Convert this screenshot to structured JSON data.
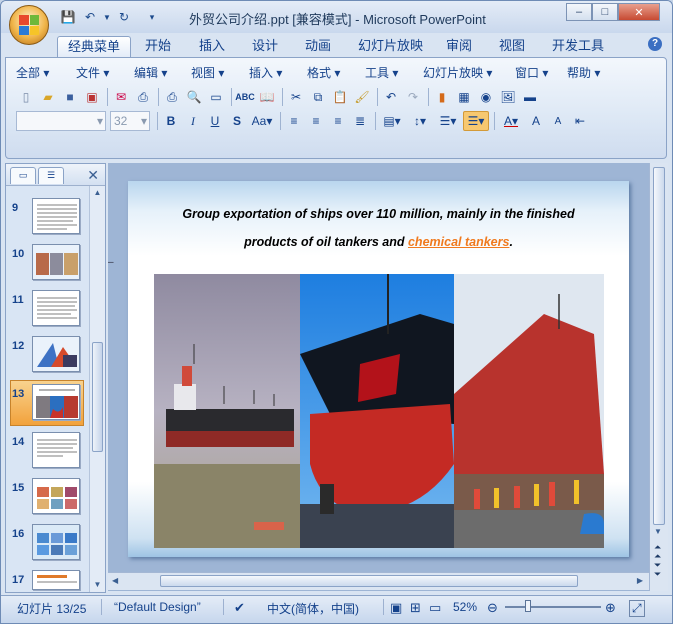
{
  "window": {
    "title": "外贸公司介绍.ppt [兼容模式] - Microsoft PowerPoint",
    "controls": {
      "minimize": "–",
      "maximize": "□",
      "close": "✕"
    }
  },
  "ribbon_tabs": [
    "经典菜单",
    "开始",
    "插入",
    "设计",
    "动画",
    "幻灯片放映",
    "审阅",
    "视图",
    "开发工具"
  ],
  "active_tab": "经典菜单",
  "classic_menu": [
    "全部",
    "文件",
    "编辑",
    "视图",
    "插入",
    "格式",
    "工具",
    "幻灯片放映",
    "窗口",
    "帮助"
  ],
  "font_size_value": "32",
  "slide_thumbnails": [
    {
      "num": "9"
    },
    {
      "num": "10"
    },
    {
      "num": "11"
    },
    {
      "num": "12"
    },
    {
      "num": "13",
      "selected": true
    },
    {
      "num": "14"
    },
    {
      "num": "15"
    },
    {
      "num": "16"
    },
    {
      "num": "17"
    }
  ],
  "slide": {
    "line1": "Group exportation of ships over 110 million, mainly in the finished",
    "line2_before": "products of oil tankers and ",
    "line2_link": "chemical tankers",
    "line2_after": "."
  },
  "status": {
    "slide_info": "幻灯片 13/25",
    "design": "“Default Design”",
    "language": "中文(简体，中国)",
    "zoom": "52%"
  },
  "colors": {
    "accent": "#15428b",
    "selected_thumb": "#f2a23c",
    "link": "#f07a1e"
  }
}
